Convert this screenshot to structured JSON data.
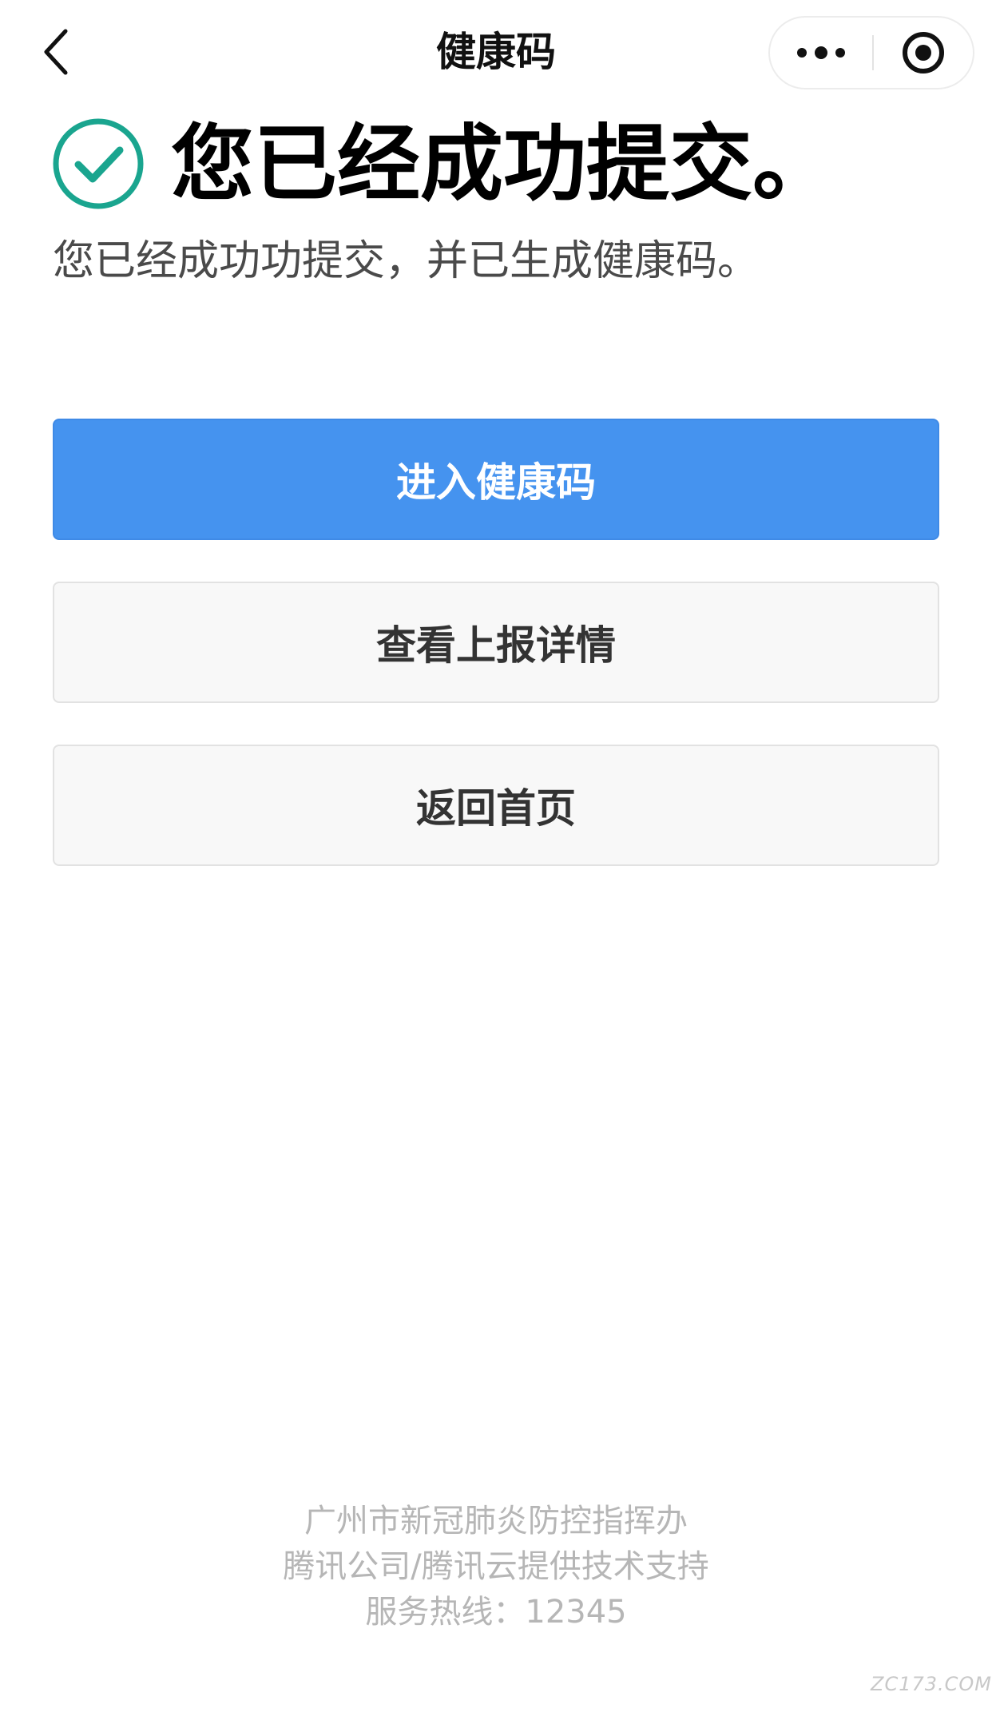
{
  "nav": {
    "title": "健康码",
    "back_icon": "chevron-left-icon",
    "more_icon": "more-dots-icon",
    "close_icon": "target-circle-icon"
  },
  "result": {
    "icon": "check-circle-icon",
    "title": "您已经成功提交。",
    "description": "您已经成功功提交，并已生成健康码。"
  },
  "buttons": {
    "enter_health_code": "进入健康码",
    "view_report_details": "查看上报详情",
    "back_home": "返回首页"
  },
  "footer": {
    "line1": "广州市新冠肺炎防控指挥办",
    "line2": "腾讯公司/腾讯云提供技术支持",
    "line3": "服务热线：12345"
  },
  "watermark": "ZC173.COM",
  "colors": {
    "primary": "#4593ef",
    "success": "#1aa58f"
  }
}
